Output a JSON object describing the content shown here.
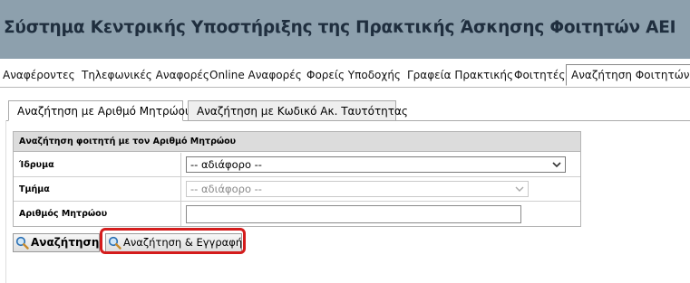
{
  "header": {
    "title": "Σύστημα Κεντρικής Υποστήριξης της Πρακτικής Άσκησης Φοιτητών ΑΕΙ"
  },
  "menu": {
    "items": [
      {
        "label": "Αναφέροντες"
      },
      {
        "label": "Τηλεφωνικές Αναφορές"
      },
      {
        "label": "Online Αναφορές"
      },
      {
        "label": "Φορείς Υποδοχής"
      },
      {
        "label": "Γραφεία Πρακτικής"
      },
      {
        "label": "Φοιτητές"
      },
      {
        "label": "Αναζήτηση Φοιτητών"
      }
    ],
    "active": "Αναζήτηση Φοιτητών"
  },
  "tabs": [
    {
      "label": "Αναζήτηση με Αριθμό Μητρώου",
      "active": true
    },
    {
      "label": "Αναζήτηση με Κωδικό Ακ. Ταυτότητας",
      "active": false
    }
  ],
  "form": {
    "heading": "Αναζήτηση φοιτητή με τον Αριθμό Μητρώου",
    "institution_label": "Ίδρυμα",
    "institution_value": "-- αδιάφορο --",
    "department_label": "Τμήμα",
    "department_value": "-- αδιάφορο --",
    "registry_label": "Αριθμός Μητρώου",
    "registry_value": ""
  },
  "buttons": {
    "search_label": "Αναζήτηση",
    "search_register_label": "Αναζήτηση & Εγγραφή"
  },
  "colors": {
    "header_bg": "#8da0ad",
    "highlight": "#d41c1c"
  },
  "icons": {
    "chevron": "chevron-down-icon",
    "search": "magnifier-icon"
  }
}
